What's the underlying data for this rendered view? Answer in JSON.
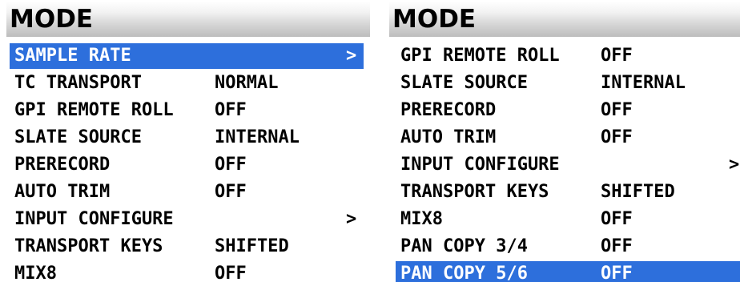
{
  "left_panel": {
    "title": "MODE",
    "rows": [
      {
        "label": "SAMPLE RATE",
        "value": "",
        "chevron": ">",
        "selected": true
      },
      {
        "label": "TC TRANSPORT",
        "value": "NORMAL",
        "chevron": "",
        "selected": false
      },
      {
        "label": "GPI REMOTE ROLL",
        "value": "OFF",
        "chevron": "",
        "selected": false
      },
      {
        "label": "SLATE SOURCE",
        "value": "INTERNAL",
        "chevron": "",
        "selected": false
      },
      {
        "label": "PRERECORD",
        "value": "OFF",
        "chevron": "",
        "selected": false
      },
      {
        "label": "AUTO TRIM",
        "value": "OFF",
        "chevron": "",
        "selected": false
      },
      {
        "label": "INPUT CONFIGURE",
        "value": "",
        "chevron": ">",
        "selected": false
      },
      {
        "label": "TRANSPORT KEYS",
        "value": "SHIFTED",
        "chevron": "",
        "selected": false
      },
      {
        "label": "MIX8",
        "value": "OFF",
        "chevron": "",
        "selected": false
      }
    ]
  },
  "right_panel": {
    "title": "MODE",
    "rows": [
      {
        "label": "GPI REMOTE ROLL",
        "value": "OFF",
        "chevron": "",
        "selected": false
      },
      {
        "label": "SLATE SOURCE",
        "value": "INTERNAL",
        "chevron": "",
        "selected": false
      },
      {
        "label": "PRERECORD",
        "value": "OFF",
        "chevron": "",
        "selected": false
      },
      {
        "label": "AUTO TRIM",
        "value": "OFF",
        "chevron": "",
        "selected": false
      },
      {
        "label": "INPUT CONFIGURE",
        "value": "",
        "chevron": ">",
        "selected": false
      },
      {
        "label": "TRANSPORT KEYS",
        "value": "SHIFTED",
        "chevron": "",
        "selected": false
      },
      {
        "label": "MIX8",
        "value": "OFF",
        "chevron": "",
        "selected": false
      },
      {
        "label": "PAN COPY 3/4",
        "value": "OFF",
        "chevron": "",
        "selected": false
      },
      {
        "label": "PAN COPY 5/6",
        "value": "OFF",
        "chevron": "",
        "selected": true
      }
    ]
  },
  "colors": {
    "selection": "#2d6fdc",
    "text": "#000000",
    "selected_text": "#ffffff",
    "background": "#ffffff"
  }
}
